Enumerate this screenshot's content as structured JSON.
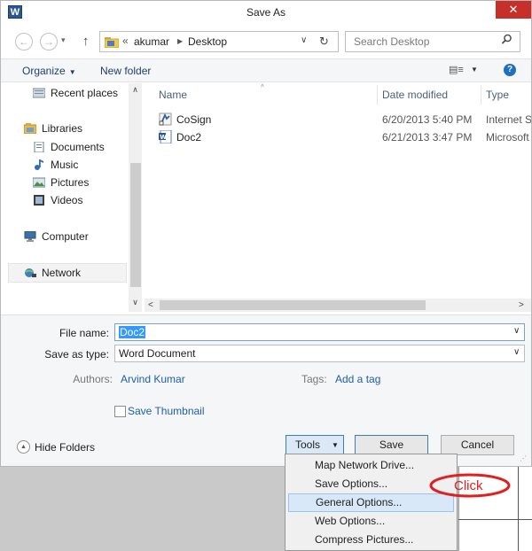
{
  "window": {
    "title": "Save As",
    "app_icon": "W",
    "close": "✕"
  },
  "nav": {
    "back": "←",
    "forward": "→",
    "recent_dropdown": "▾",
    "up": "↑",
    "address": {
      "chevron": "«",
      "crumbs": [
        "akumar",
        "Desktop"
      ],
      "separator": "▶",
      "dropdown": "∨",
      "refresh": "↻"
    },
    "search_placeholder": "Search Desktop"
  },
  "toolbar": {
    "organize": "Organize",
    "organize_caret": "▼",
    "new_folder": "New folder",
    "view_icon": "▤≡",
    "view_caret": "▼",
    "help": "?"
  },
  "sidebar": {
    "items": [
      {
        "label": "Recent places",
        "icon": "recent-places-icon"
      },
      {
        "label": "Libraries",
        "icon": "libraries-icon"
      },
      {
        "label": "Documents",
        "icon": "documents-icon"
      },
      {
        "label": "Music",
        "icon": "music-icon"
      },
      {
        "label": "Pictures",
        "icon": "pictures-icon"
      },
      {
        "label": "Videos",
        "icon": "videos-icon"
      },
      {
        "label": "Computer",
        "icon": "computer-icon"
      },
      {
        "label": "Network",
        "icon": "network-icon"
      }
    ],
    "scroll_up": "∧",
    "scroll_down": "∨"
  },
  "files": {
    "columns": [
      "Name",
      "Date modified",
      "Type"
    ],
    "sort_indicator": "^",
    "rows": [
      {
        "name": "CoSign",
        "date": "6/20/2013 5:40 PM",
        "type": "Internet S",
        "icon": "cosign-shortcut-icon"
      },
      {
        "name": "Doc2",
        "date": "6/21/2013 3:47 PM",
        "type": "Microsoft",
        "icon": "word-document-icon"
      }
    ],
    "hscroll_left": "<",
    "hscroll_right": ">"
  },
  "form": {
    "file_name_label": "File name:",
    "file_name_value": "Doc2",
    "save_type_label": "Save as type:",
    "save_type_value": "Word Document",
    "dropdown": "∨",
    "authors_label": "Authors:",
    "authors_value": "Arvind Kumar",
    "tags_label": "Tags:",
    "tags_value": "Add a tag",
    "thumbnail_label": "Save Thumbnail",
    "thumbnail_checked": false
  },
  "buttons": {
    "hide_folders": "Hide Folders",
    "hide_icon": "▲",
    "tools": "Tools",
    "tools_caret": "▼",
    "save": "Save",
    "cancel": "Cancel",
    "grip": "⋰"
  },
  "tools_menu": {
    "items": [
      "Map Network Drive...",
      "Save Options...",
      "General Options...",
      "Web Options...",
      "Compress Pictures..."
    ],
    "highlighted": "General Options..."
  },
  "annotation": {
    "text": "Click",
    "color": "#e02020"
  }
}
